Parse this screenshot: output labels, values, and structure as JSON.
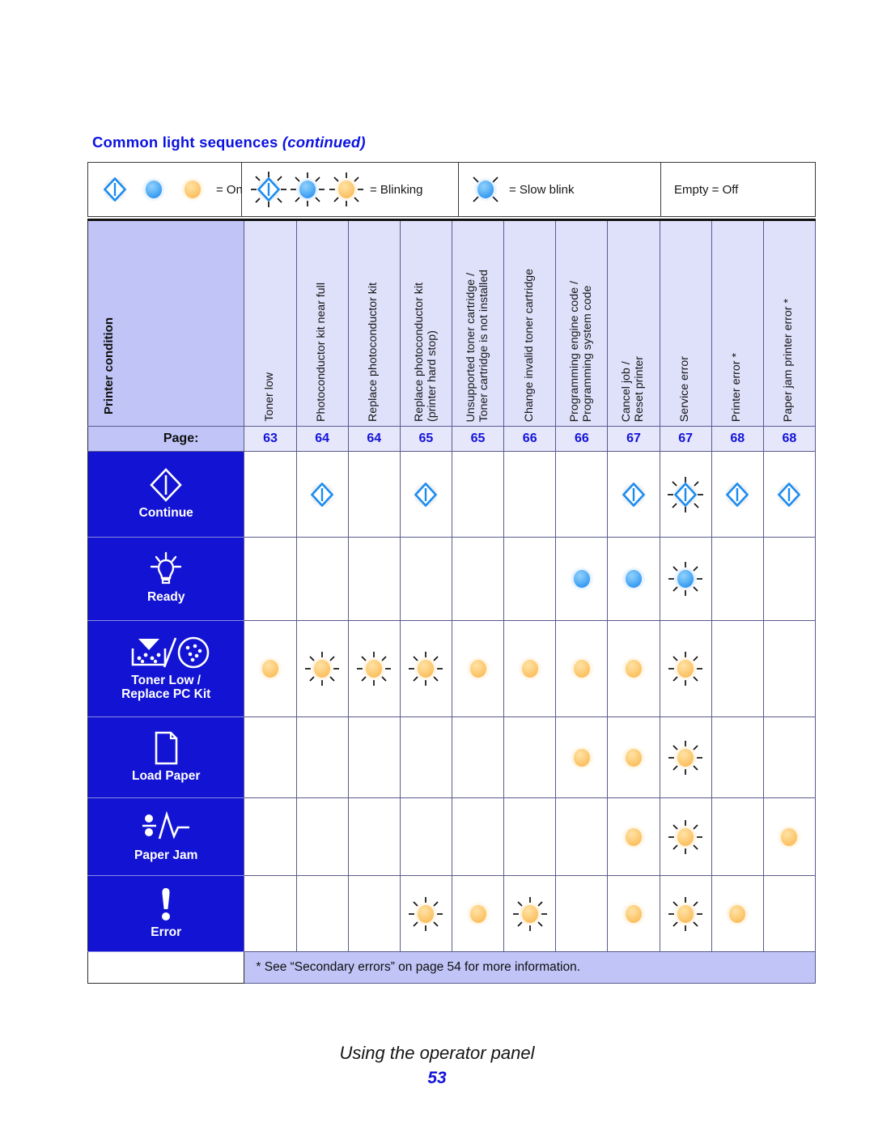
{
  "header": {
    "title_main": "Common light sequences",
    "title_continued": "(continued)"
  },
  "legend": {
    "on_label": "= On",
    "blinking_label": "= Blinking",
    "slow_blink_label": "= Slow blink",
    "off_label": "Empty = Off"
  },
  "table": {
    "condition_header": "Printer condition",
    "page_label": "Page:",
    "columns": [
      {
        "label": "Toner low",
        "page": "63"
      },
      {
        "label": "Photoconductor kit near full",
        "page": "64"
      },
      {
        "label": "Replace photoconductor kit",
        "page": "64"
      },
      {
        "label": "Replace photoconductor kit\n(printer hard stop)",
        "page": "65"
      },
      {
        "label": "Unsupported toner cartridge /\nToner cartridge is not installed",
        "page": "65"
      },
      {
        "label": "Change invalid toner cartridge",
        "page": "66"
      },
      {
        "label": "Programming engine code /\nProgramming system code",
        "page": "66"
      },
      {
        "label": "Cancel job /\nReset printer",
        "page": "67"
      },
      {
        "label": "Service error",
        "page": "67"
      },
      {
        "label": "Printer error *",
        "page": "68"
      },
      {
        "label": "Paper jam printer error *",
        "page": "68"
      }
    ],
    "rows": [
      {
        "name": "Continue",
        "label": "Continue",
        "icon": "continue-diamond-icon",
        "states": [
          "off",
          "on",
          "off",
          "on",
          "off",
          "off",
          "off",
          "on",
          "blinking",
          "on",
          "on"
        ]
      },
      {
        "name": "Ready",
        "label": "Ready",
        "icon": "ready-lamp-icon",
        "states": [
          "off",
          "off",
          "off",
          "off",
          "off",
          "off",
          "on-blue",
          "on-blue",
          "blinking-blue",
          "off",
          "off"
        ]
      },
      {
        "name": "Toner Low / Replace PC Kit",
        "label": "Toner Low /\nReplace PC Kit",
        "icon": "toner-low-icon",
        "states": [
          "on-amber",
          "blinking-amber",
          "blinking-amber",
          "blinking-amber",
          "on-amber",
          "on-amber",
          "on-amber",
          "on-amber",
          "blinking-amber",
          "off",
          "off"
        ]
      },
      {
        "name": "Load Paper",
        "label": "Load Paper",
        "icon": "load-paper-icon",
        "states": [
          "off",
          "off",
          "off",
          "off",
          "off",
          "off",
          "on-amber",
          "on-amber",
          "blinking-amber",
          "off",
          "off"
        ]
      },
      {
        "name": "Paper Jam",
        "label": "Paper Jam",
        "icon": "paper-jam-icon",
        "states": [
          "off",
          "off",
          "off",
          "off",
          "off",
          "off",
          "off",
          "on-amber",
          "blinking-amber",
          "off",
          "on-amber"
        ]
      },
      {
        "name": "Error",
        "label": "Error",
        "icon": "error-exclamation-icon",
        "states": [
          "off",
          "off",
          "off",
          "blinking-amber",
          "on-amber",
          "blinking-amber",
          "off",
          "on-amber",
          "blinking-amber",
          "on-amber",
          "off"
        ]
      }
    ],
    "footnote": "* See “Secondary errors” on page 54 for more information."
  },
  "footer": {
    "section": "Using the operator panel",
    "page_number": "53"
  },
  "colors": {
    "brand_blue": "#1414d8",
    "condition_fill": "#1313d4",
    "header_fill": "#c0c4f6",
    "cell_fill": "#dfe0fa",
    "amber": "#fbc163",
    "blue_light": "#3a9cf2"
  }
}
